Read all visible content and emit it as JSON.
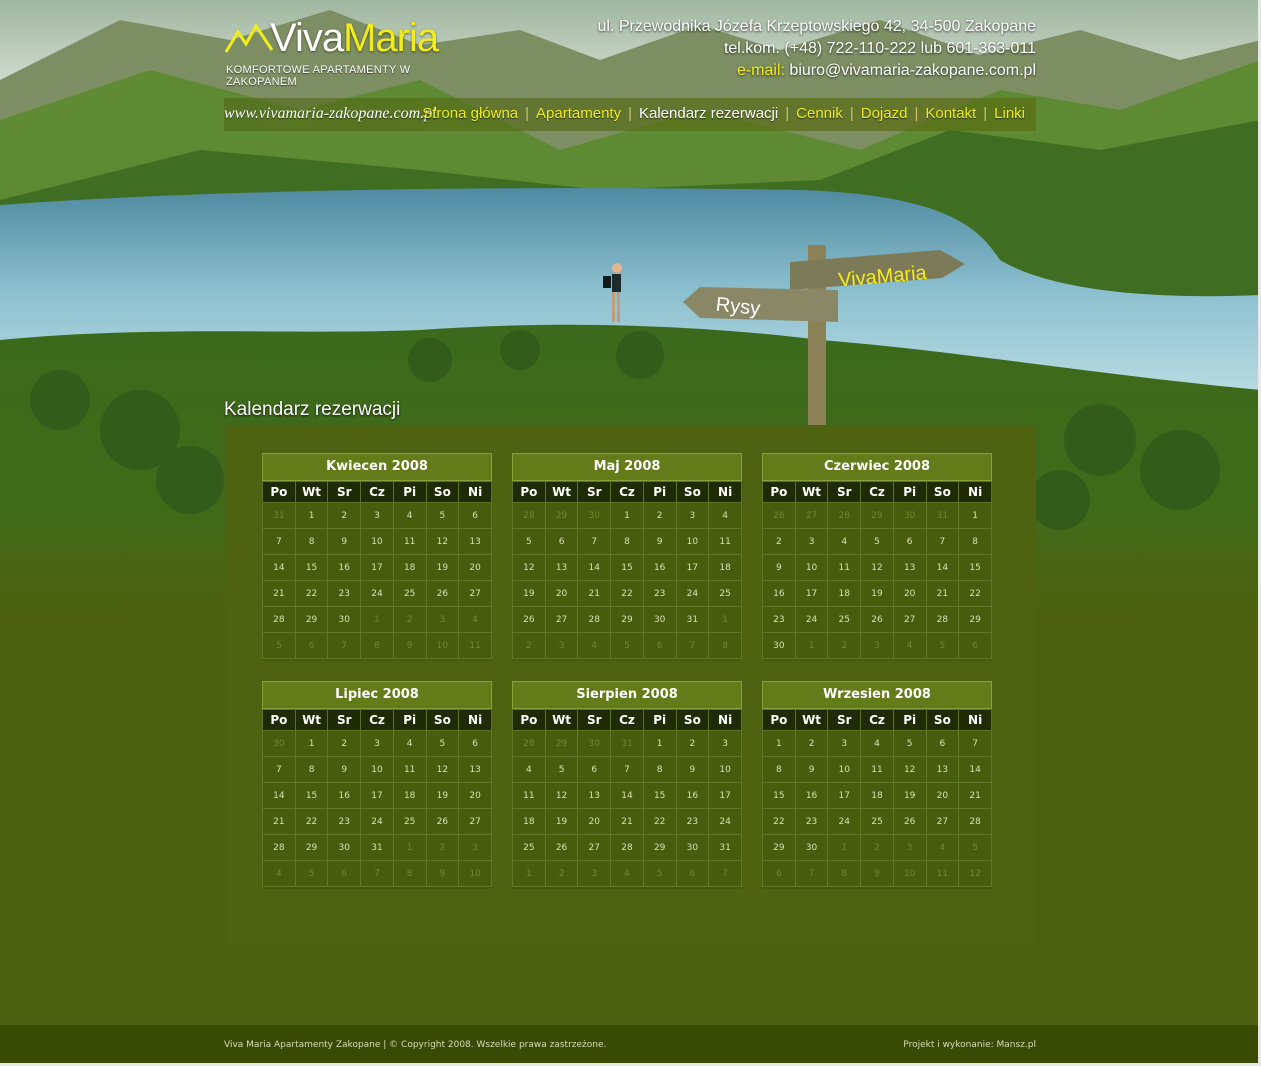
{
  "brand": {
    "name_part1": "Viva",
    "name_part2": "Maria",
    "tagline": "KOMFORTOWE APARTAMENTY W ZAKOPANEM",
    "url": "www.vivamaria-zakopane.com.pl"
  },
  "contact": {
    "address": "ul. Przewodnika Józefa Krzeptowskiego 42, 34-500 Zakopane",
    "phone": "tel.kom. (+48) 722-110-222 lub 601-363-011",
    "email_label": "e-mail:",
    "email": "biuro@vivamaria-zakopane.com.pl"
  },
  "nav": {
    "items": [
      "Strona główna",
      "Apartamenty",
      "Kalendarz rezerwacji",
      "Cennik",
      "Dojazd",
      "Kontakt",
      "Linki"
    ],
    "active": "Kalendarz rezerwacji"
  },
  "scene_signs": {
    "sign1": "VivaMaria",
    "sign2": "Rysy"
  },
  "page": {
    "title": "Kalendarz rezerwacji"
  },
  "calendar": {
    "weekdays": [
      "Po",
      "Wt",
      "Sr",
      "Cz",
      "Pi",
      "So",
      "Ni"
    ],
    "months": [
      {
        "title": "Kwiecen 2008",
        "weeks": [
          [
            "31",
            "1",
            "2",
            "3",
            "4",
            "5",
            "6"
          ],
          [
            "7",
            "8",
            "9",
            "10",
            "11",
            "12",
            "13"
          ],
          [
            "14",
            "15",
            "16",
            "17",
            "18",
            "19",
            "20"
          ],
          [
            "21",
            "22",
            "23",
            "24",
            "25",
            "26",
            "27"
          ],
          [
            "28",
            "29",
            "30",
            "1",
            "2",
            "3",
            "4"
          ],
          [
            "5",
            "6",
            "7",
            "8",
            "9",
            "10",
            "11"
          ]
        ],
        "other_month": [
          [
            0,
            0
          ],
          [
            4,
            3
          ],
          [
            4,
            4
          ],
          [
            4,
            5
          ],
          [
            4,
            6
          ],
          [
            5,
            0
          ],
          [
            5,
            1
          ],
          [
            5,
            2
          ],
          [
            5,
            3
          ],
          [
            5,
            4
          ],
          [
            5,
            5
          ],
          [
            5,
            6
          ]
        ]
      },
      {
        "title": "Maj 2008",
        "weeks": [
          [
            "28",
            "29",
            "30",
            "1",
            "2",
            "3",
            "4"
          ],
          [
            "5",
            "6",
            "7",
            "8",
            "9",
            "10",
            "11"
          ],
          [
            "12",
            "13",
            "14",
            "15",
            "16",
            "17",
            "18"
          ],
          [
            "19",
            "20",
            "21",
            "22",
            "23",
            "24",
            "25"
          ],
          [
            "26",
            "27",
            "28",
            "29",
            "30",
            "31",
            "1"
          ],
          [
            "2",
            "3",
            "4",
            "5",
            "6",
            "7",
            "8"
          ]
        ],
        "other_month": [
          [
            0,
            0
          ],
          [
            0,
            1
          ],
          [
            0,
            2
          ],
          [
            4,
            6
          ],
          [
            5,
            0
          ],
          [
            5,
            1
          ],
          [
            5,
            2
          ],
          [
            5,
            3
          ],
          [
            5,
            4
          ],
          [
            5,
            5
          ],
          [
            5,
            6
          ]
        ]
      },
      {
        "title": "Czerwiec 2008",
        "weeks": [
          [
            "26",
            "27",
            "28",
            "29",
            "30",
            "31",
            "1"
          ],
          [
            "2",
            "3",
            "4",
            "5",
            "6",
            "7",
            "8"
          ],
          [
            "9",
            "10",
            "11",
            "12",
            "13",
            "14",
            "15"
          ],
          [
            "16",
            "17",
            "18",
            "19",
            "20",
            "21",
            "22"
          ],
          [
            "23",
            "24",
            "25",
            "26",
            "27",
            "28",
            "29"
          ],
          [
            "30",
            "1",
            "2",
            "3",
            "4",
            "5",
            "6"
          ]
        ],
        "other_month": [
          [
            0,
            0
          ],
          [
            0,
            1
          ],
          [
            0,
            2
          ],
          [
            0,
            3
          ],
          [
            0,
            4
          ],
          [
            0,
            5
          ],
          [
            5,
            1
          ],
          [
            5,
            2
          ],
          [
            5,
            3
          ],
          [
            5,
            4
          ],
          [
            5,
            5
          ],
          [
            5,
            6
          ]
        ]
      },
      {
        "title": "Lipiec 2008",
        "weeks": [
          [
            "30",
            "1",
            "2",
            "3",
            "4",
            "5",
            "6"
          ],
          [
            "7",
            "8",
            "9",
            "10",
            "11",
            "12",
            "13"
          ],
          [
            "14",
            "15",
            "16",
            "17",
            "18",
            "19",
            "20"
          ],
          [
            "21",
            "22",
            "23",
            "24",
            "25",
            "26",
            "27"
          ],
          [
            "28",
            "29",
            "30",
            "31",
            "1",
            "2",
            "3"
          ],
          [
            "4",
            "5",
            "6",
            "7",
            "8",
            "9",
            "10"
          ]
        ],
        "other_month": [
          [
            0,
            0
          ],
          [
            4,
            4
          ],
          [
            4,
            5
          ],
          [
            4,
            6
          ],
          [
            5,
            0
          ],
          [
            5,
            1
          ],
          [
            5,
            2
          ],
          [
            5,
            3
          ],
          [
            5,
            4
          ],
          [
            5,
            5
          ],
          [
            5,
            6
          ]
        ]
      },
      {
        "title": "Sierpien 2008",
        "weeks": [
          [
            "28",
            "29",
            "30",
            "31",
            "1",
            "2",
            "3"
          ],
          [
            "4",
            "5",
            "6",
            "7",
            "8",
            "9",
            "10"
          ],
          [
            "11",
            "12",
            "13",
            "14",
            "15",
            "16",
            "17"
          ],
          [
            "18",
            "19",
            "20",
            "21",
            "22",
            "23",
            "24"
          ],
          [
            "25",
            "26",
            "27",
            "28",
            "29",
            "30",
            "31"
          ],
          [
            "1",
            "2",
            "3",
            "4",
            "5",
            "6",
            "7"
          ]
        ],
        "other_month": [
          [
            0,
            0
          ],
          [
            0,
            1
          ],
          [
            0,
            2
          ],
          [
            0,
            3
          ],
          [
            5,
            0
          ],
          [
            5,
            1
          ],
          [
            5,
            2
          ],
          [
            5,
            3
          ],
          [
            5,
            4
          ],
          [
            5,
            5
          ],
          [
            5,
            6
          ]
        ]
      },
      {
        "title": "Wrzesien 2008",
        "weeks": [
          [
            "1",
            "2",
            "3",
            "4",
            "5",
            "6",
            "7"
          ],
          [
            "8",
            "9",
            "10",
            "11",
            "12",
            "13",
            "14"
          ],
          [
            "15",
            "16",
            "17",
            "18",
            "19",
            "20",
            "21"
          ],
          [
            "22",
            "23",
            "24",
            "25",
            "26",
            "27",
            "28"
          ],
          [
            "29",
            "30",
            "1",
            "2",
            "3",
            "4",
            "5"
          ],
          [
            "6",
            "7",
            "8",
            "9",
            "10",
            "11",
            "12"
          ]
        ],
        "other_month": [
          [
            4,
            2
          ],
          [
            4,
            3
          ],
          [
            4,
            4
          ],
          [
            4,
            5
          ],
          [
            4,
            6
          ],
          [
            5,
            0
          ],
          [
            5,
            1
          ],
          [
            5,
            2
          ],
          [
            5,
            3
          ],
          [
            5,
            4
          ],
          [
            5,
            5
          ],
          [
            5,
            6
          ]
        ]
      }
    ]
  },
  "footer": {
    "left": "Viva Maria Apartamenty Zakopane | © Copyright 2008. Wszelkie prawa zastrzeżone.",
    "right": "Projekt i wykonanie: Mansz.pl"
  },
  "colors": {
    "accent_yellow": "#f2ed1a",
    "page_green": "#4c600f",
    "calendar_header": "#637c19",
    "footer": "#394a05"
  }
}
